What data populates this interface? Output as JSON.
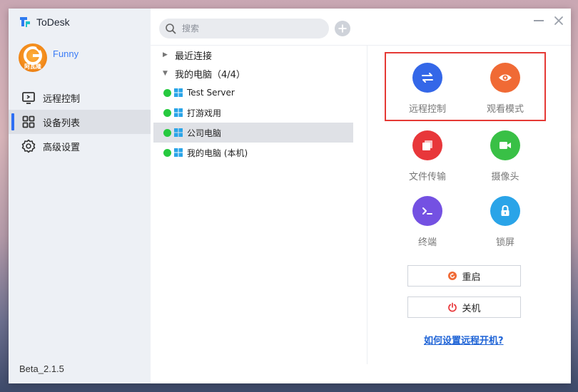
{
  "app": {
    "name": "ToDesk",
    "version": "Beta_2.1.5"
  },
  "user": {
    "name": "Funny",
    "avatar_text": "阿瓦隆"
  },
  "sidebar": {
    "items": [
      {
        "label": "远程控制",
        "icon": "monitor-icon"
      },
      {
        "label": "设备列表",
        "icon": "grid-icon",
        "active": true
      },
      {
        "label": "高级设置",
        "icon": "gear-icon"
      }
    ]
  },
  "search": {
    "placeholder": "搜索"
  },
  "tree": {
    "groups": [
      {
        "label": "最近连接",
        "expanded": false
      },
      {
        "label": "我的电脑（4/4）",
        "expanded": true
      }
    ],
    "devices": [
      {
        "name": "Test Server",
        "status": "online"
      },
      {
        "name": "打游戏用",
        "status": "online"
      },
      {
        "name": "公司电脑",
        "status": "online",
        "selected": true
      },
      {
        "name": "我的电脑 (本机)",
        "status": "online"
      }
    ]
  },
  "actions": [
    {
      "label": "远程控制",
      "icon": "swap-arrows-icon",
      "color": "#3467e8"
    },
    {
      "label": "观看模式",
      "icon": "eye-icon",
      "color": "#f06a35"
    },
    {
      "label": "文件传输",
      "icon": "files-icon",
      "color": "#e8373a"
    },
    {
      "label": "摄像头",
      "icon": "video-camera-icon",
      "color": "#39c046"
    },
    {
      "label": "终端",
      "icon": "terminal-icon",
      "color": "#7451e2"
    },
    {
      "label": "锁屏",
      "icon": "lock-icon",
      "color": "#2aa4e8"
    }
  ],
  "buttons": {
    "restart": "重启",
    "shutdown": "关机"
  },
  "links": {
    "wake_help": "如何设置远程开机?"
  },
  "colors": {
    "accent": "#2f6ff3",
    "online": "#27c93f",
    "highlight": "#e53935"
  }
}
